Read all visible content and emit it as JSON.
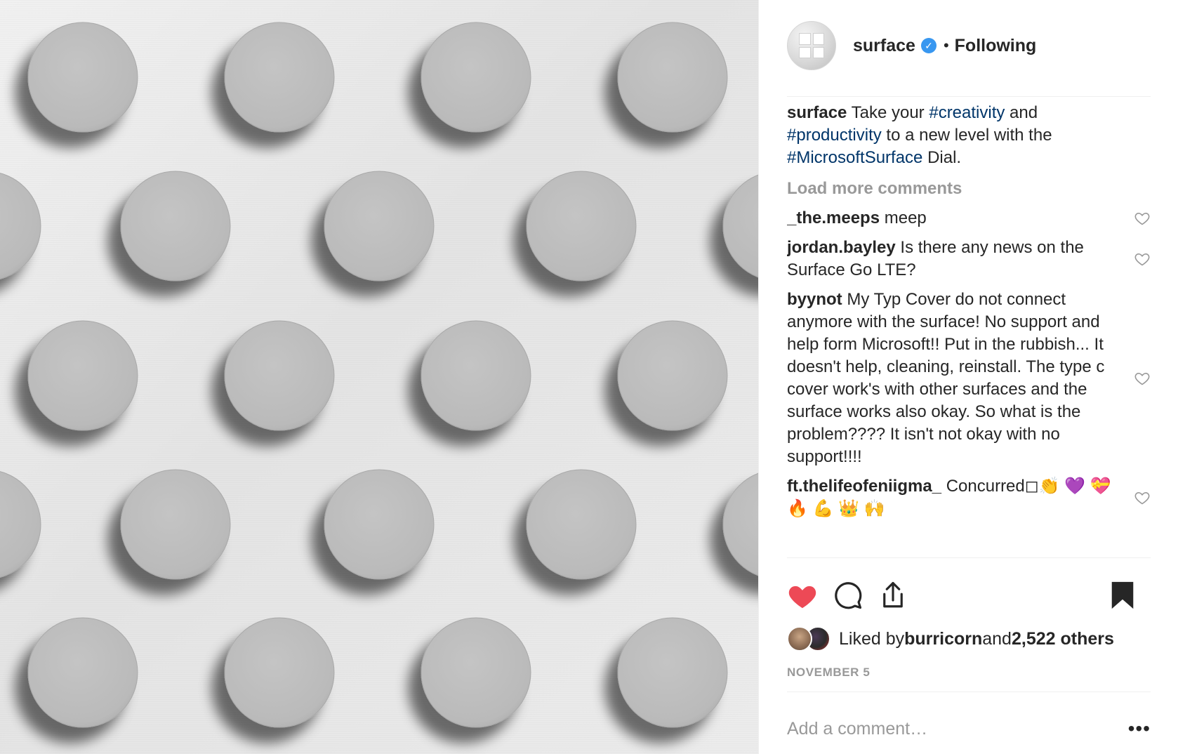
{
  "post": {
    "media": {
      "alt_icon": "surface-dial-pattern"
    },
    "header": {
      "username": "surface",
      "verified_icon": "verified-badge-icon",
      "separator": "•",
      "follow_status": "Following"
    },
    "caption": {
      "username": "surface",
      "text_1": " Take your ",
      "tag_1": "#creativity",
      "text_2": " and ",
      "tag_2": "#productivity",
      "text_3": " to a new level with the ",
      "tag_3": "#MicrosoftSurface",
      "text_4": " Dial."
    },
    "load_more": "Load more comments",
    "comments": [
      {
        "username": "_the.meeps",
        "text": " meep"
      },
      {
        "username": "jordan.bayley",
        "text": " Is there any news on the Surface Go LTE?"
      },
      {
        "username": "byynot",
        "text": " My Typ Cover do not connect anymore with the surface! No support and help form Microsoft!! Put in the rubbish... It doesn't help, cleaning, reinstall. The type c cover work's with other surfaces and the surface works also okay. So what is the problem???? It isn't not okay with no support!!!!"
      },
      {
        "username": "ft.thelifeofeniigma_",
        "text": " Concurred◻👏 💜 💝 🔥 💪 👑 🙌"
      }
    ],
    "actions": {
      "like_icon": "heart-filled-icon",
      "comment_icon": "comment-bubble-icon",
      "share_icon": "share-icon",
      "save_icon": "bookmark-icon",
      "like_color": "#ed4956"
    },
    "likes": {
      "prefix": "Liked by ",
      "user": "burricorn",
      "middle": " and ",
      "others": "2,522 others"
    },
    "date": "NOVEMBER 5",
    "add_comment": {
      "placeholder": "Add a comment…",
      "more_label": "•••"
    }
  }
}
